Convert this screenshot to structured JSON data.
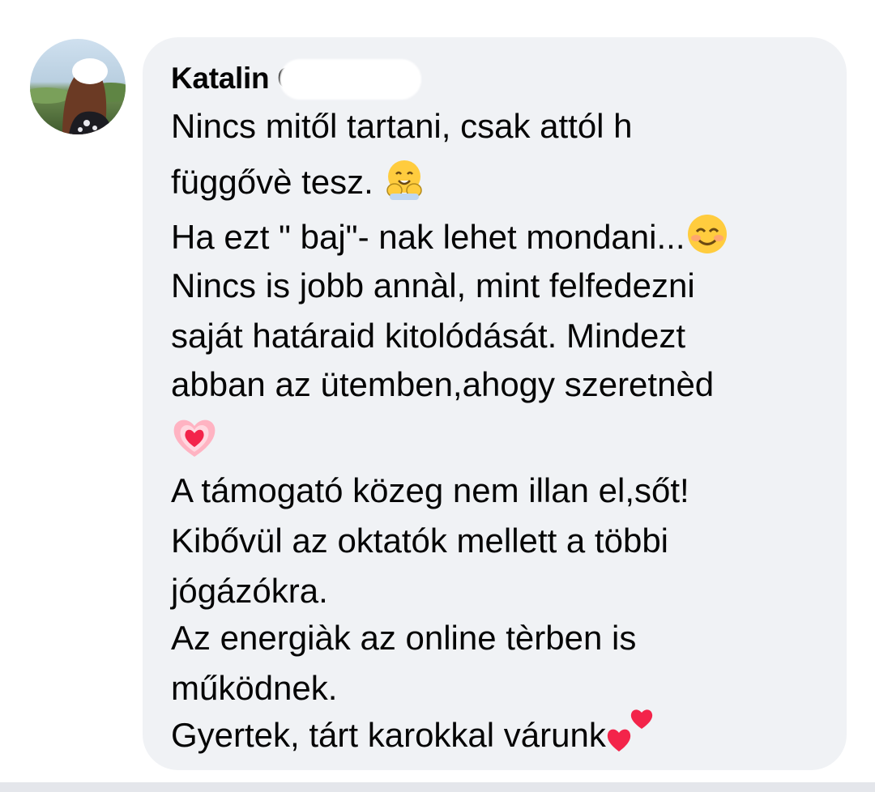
{
  "comment": {
    "author": "Katalin C",
    "lines": [
      "Nincs mitől tartani, csak attól h",
      "függővè tesz.",
      "Ha ezt \" baj\"- nak lehet mondani...",
      "Nincs is jobb annàl, mint felfedezni",
      "saját határaid kitolódását. Mindezt",
      "abban az ütemben,ahogy szeretnèd",
      "A támogató közeg nem illan el,sőt!",
      "Kibővül az oktatók mellett a többi",
      "jógázókra.",
      "Az energiàk az online tèrben is",
      "működnek.",
      "Gyertek, tárt karokkal várunk"
    ],
    "emojis": {
      "line2": "hugging-face-emoji",
      "line3": "smiling-face-emoji",
      "line_heart": "glowing-heart-emoji",
      "line_last": "two-hearts-emoji"
    }
  },
  "colors": {
    "bubble_bg": "#f0f2f5",
    "text": "#050505"
  }
}
